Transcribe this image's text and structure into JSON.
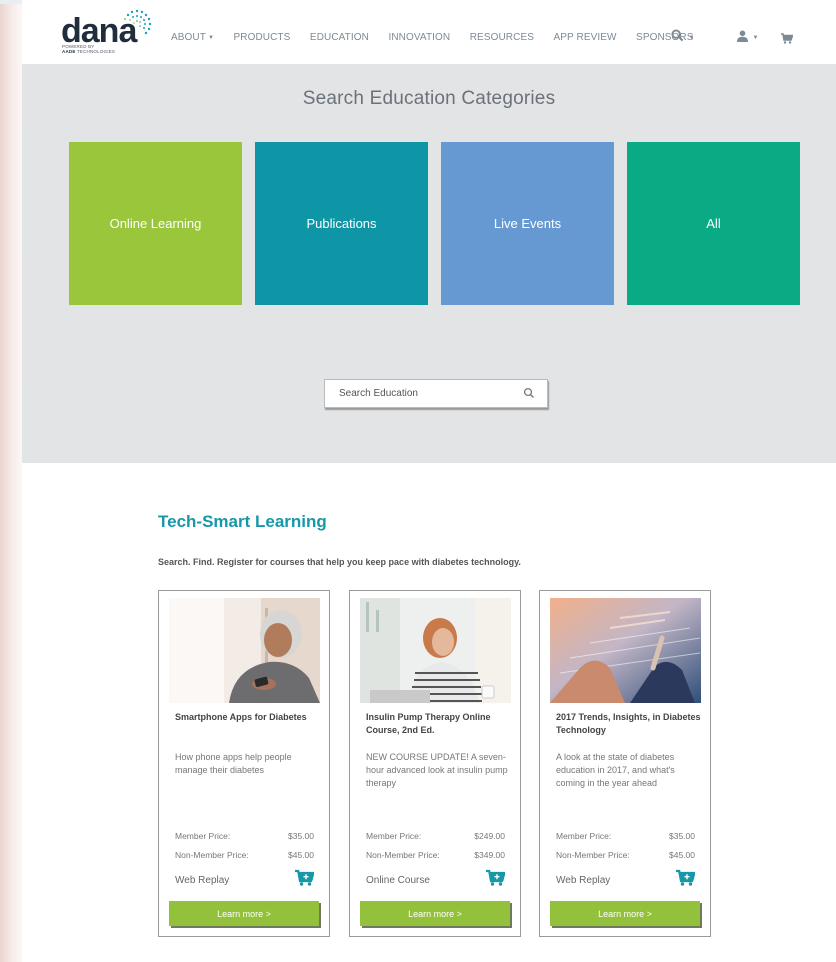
{
  "header": {
    "logo": {
      "word": "dana",
      "powered": "POWERED BY",
      "company_bold": "AADE",
      "company": "TECHNOLOGIES"
    },
    "nav": [
      {
        "label": "ABOUT",
        "dropdown": true
      },
      {
        "label": "PRODUCTS"
      },
      {
        "label": "EDUCATION"
      },
      {
        "label": "INNOVATION"
      },
      {
        "label": "RESOURCES"
      },
      {
        "label": "APP REVIEW"
      },
      {
        "label": "SPONSORS"
      }
    ],
    "icons": [
      "search-icon",
      "user-icon",
      "cart-icon"
    ]
  },
  "hero": {
    "title": "Search Education Categories",
    "tiles": [
      {
        "label": "Online Learning",
        "color": "#9ac63c"
      },
      {
        "label": "Publications",
        "color": "#0e95a6"
      },
      {
        "label": "Live Events",
        "color": "#6699d1"
      },
      {
        "label": "All",
        "color": "#0aab84"
      }
    ],
    "search": {
      "placeholder": "Search Education",
      "value": ""
    }
  },
  "section": {
    "title": "Tech-Smart Learning",
    "subtitle": "Search. Find. Register for courses that help you keep pace with diabetes technology."
  },
  "cards": [
    {
      "title": "Smartphone Apps for Diabetes",
      "description": "How phone apps help people manage their diabetes",
      "member_label": "Member Price:",
      "member_price": "$35.00",
      "nonmember_label": "Non-Member Price:",
      "nonmember_price": "$45.00",
      "type": "Web Replay",
      "button": "Learn more >"
    },
    {
      "title": "Insulin Pump Therapy Online Course, 2nd Ed.",
      "description": "NEW COURSE UPDATE! A seven-hour advanced look at insulin pump therapy",
      "member_label": "Member Price:",
      "member_price": "$249.00",
      "nonmember_label": "Non-Member Price:",
      "nonmember_price": "$349.00",
      "type": "Online Course",
      "button": "Learn more >"
    },
    {
      "title": "2017 Trends, Insights, in Diabetes Technology",
      "description": "A look at the state of diabetes education in 2017, and what's coming in the year ahead",
      "member_label": "Member Price:",
      "member_price": "$35.00",
      "nonmember_label": "Non-Member Price:",
      "nonmember_price": "$45.00",
      "type": "Web Replay",
      "button": "Learn more >"
    }
  ],
  "colors": {
    "accent": "#1798a8",
    "button_green": "#93c13c",
    "hero_bg": "#e3e4e6"
  }
}
